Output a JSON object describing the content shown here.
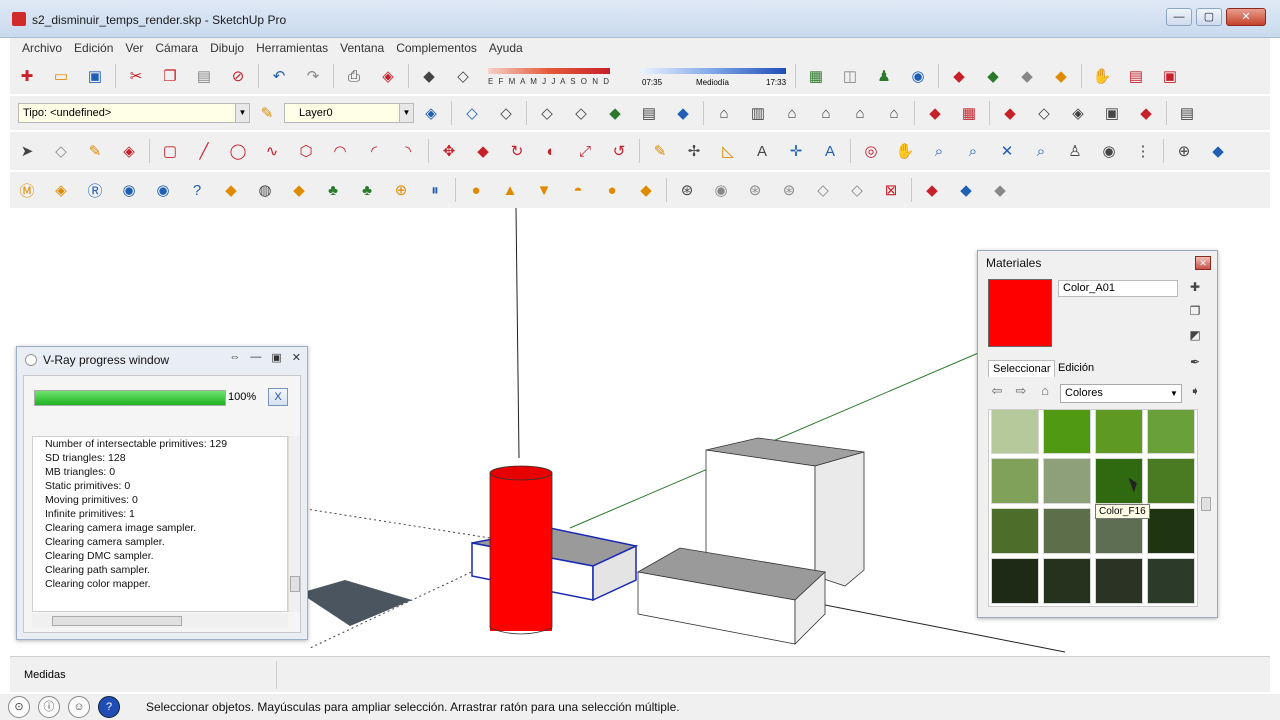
{
  "window": {
    "title": "s2_disminuir_temps_render.skp - SketchUp Pro",
    "minimize": "—",
    "maximize": "▢",
    "close": "✕"
  },
  "menu": [
    "Archivo",
    "Edición",
    "Ver",
    "Cámara",
    "Dibujo",
    "Herramientas",
    "Ventana",
    "Complementos",
    "Ayuda"
  ],
  "toolbar": {
    "tipo_value": "Tipo: <undefined>",
    "layer_value": "Layer0",
    "shadow_months": "E F M A M J J A S O N D",
    "time_start": "07:35",
    "time_mid": "Mediodía",
    "time_end": "17:33",
    "row1_icons": [
      "new-file",
      "open-folder",
      "save",
      "cut",
      "copy",
      "paste",
      "erase",
      "undo",
      "redo",
      "print",
      "model-info"
    ],
    "row1_right_icons": [
      "shadow-toggle",
      "fog-toggle"
    ],
    "row1_far_icons": [
      "map",
      "paper",
      "person",
      "globe",
      "ruby-red",
      "ruby-green",
      "ruby-gray",
      "ruby-orange",
      "hand",
      "panel-red",
      "panel-green"
    ]
  },
  "vray": {
    "title": "V-Ray progress window",
    "percent": "100%",
    "progress": 1.0,
    "cancel": "X",
    "log": [
      "Number of intersectable primitives: 129",
      "SD triangles: 128",
      "MB triangles: 0",
      "Static primitives: 0",
      "Moving primitives: 0",
      "Infinite primitives: 1",
      "Clearing camera image sampler.",
      "Clearing camera sampler.",
      "Clearing DMC sampler.",
      "Clearing path sampler.",
      "Clearing color mapper."
    ]
  },
  "materials": {
    "title": "Materiales",
    "material_name": "Color_A01",
    "swatch_color": "#ff0000",
    "tab_select": "Seleccionar",
    "tab_edit": "Edición",
    "library": "Colores",
    "tooltip": "Color_F16",
    "swatches": [
      "#b5c99a",
      "#4f9a12",
      "#5e9a22",
      "#6aa03a",
      "#7fa15a",
      "#8ea07a",
      "#2f6a10",
      "#4a7a22",
      "#4c6e2a",
      "#5c6e4a",
      "#5e6e52",
      "#1f3410",
      "#1e2a16",
      "#24321e",
      "#2a3324",
      "#2c3a2a"
    ]
  },
  "measurements_label": "Medidas",
  "status": {
    "text": "Seleccionar objetos. Mayúsculas para ampliar selección. Arrastrar ratón para una selección múltiple.",
    "help": "?"
  }
}
